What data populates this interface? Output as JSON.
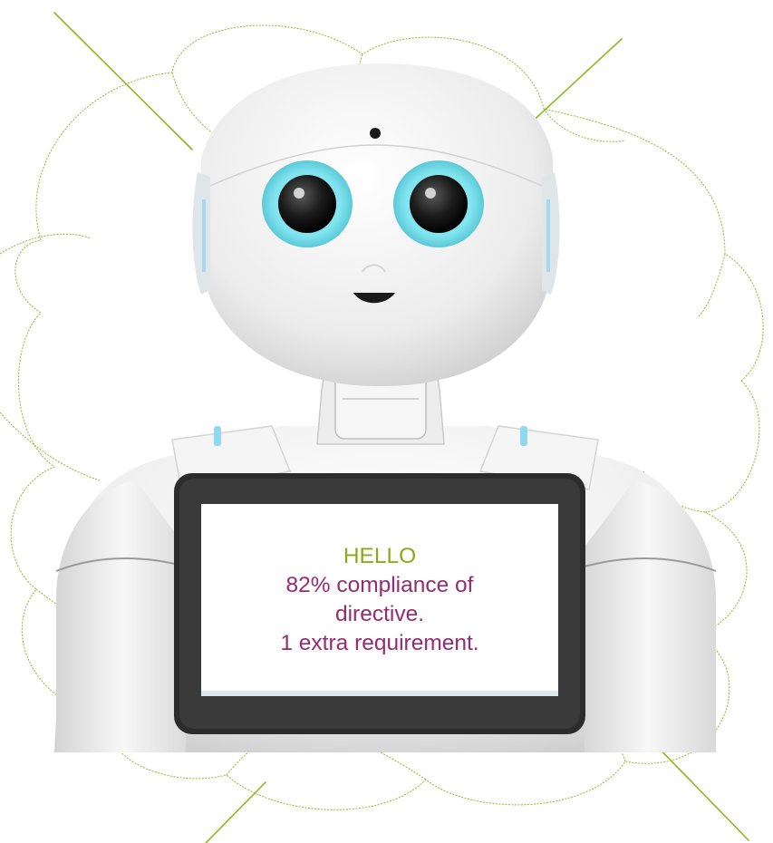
{
  "screen": {
    "greeting": "HELLO",
    "line1": "82% compliance of",
    "line2": "directive.",
    "line3": "1 extra requirement."
  },
  "colors": {
    "greeting": "#8aaa1a",
    "message": "#962a73",
    "cloud_outline": "#9bb22d",
    "burst_lines": "#8db81c",
    "robot_body": "#f1f1f1",
    "eye_glow": "#7fe3ee",
    "tablet_bezel": "#2c2c2c"
  },
  "icons": [
    "thought-cloud-outline",
    "burst-lines",
    "humanoid-robot"
  ]
}
